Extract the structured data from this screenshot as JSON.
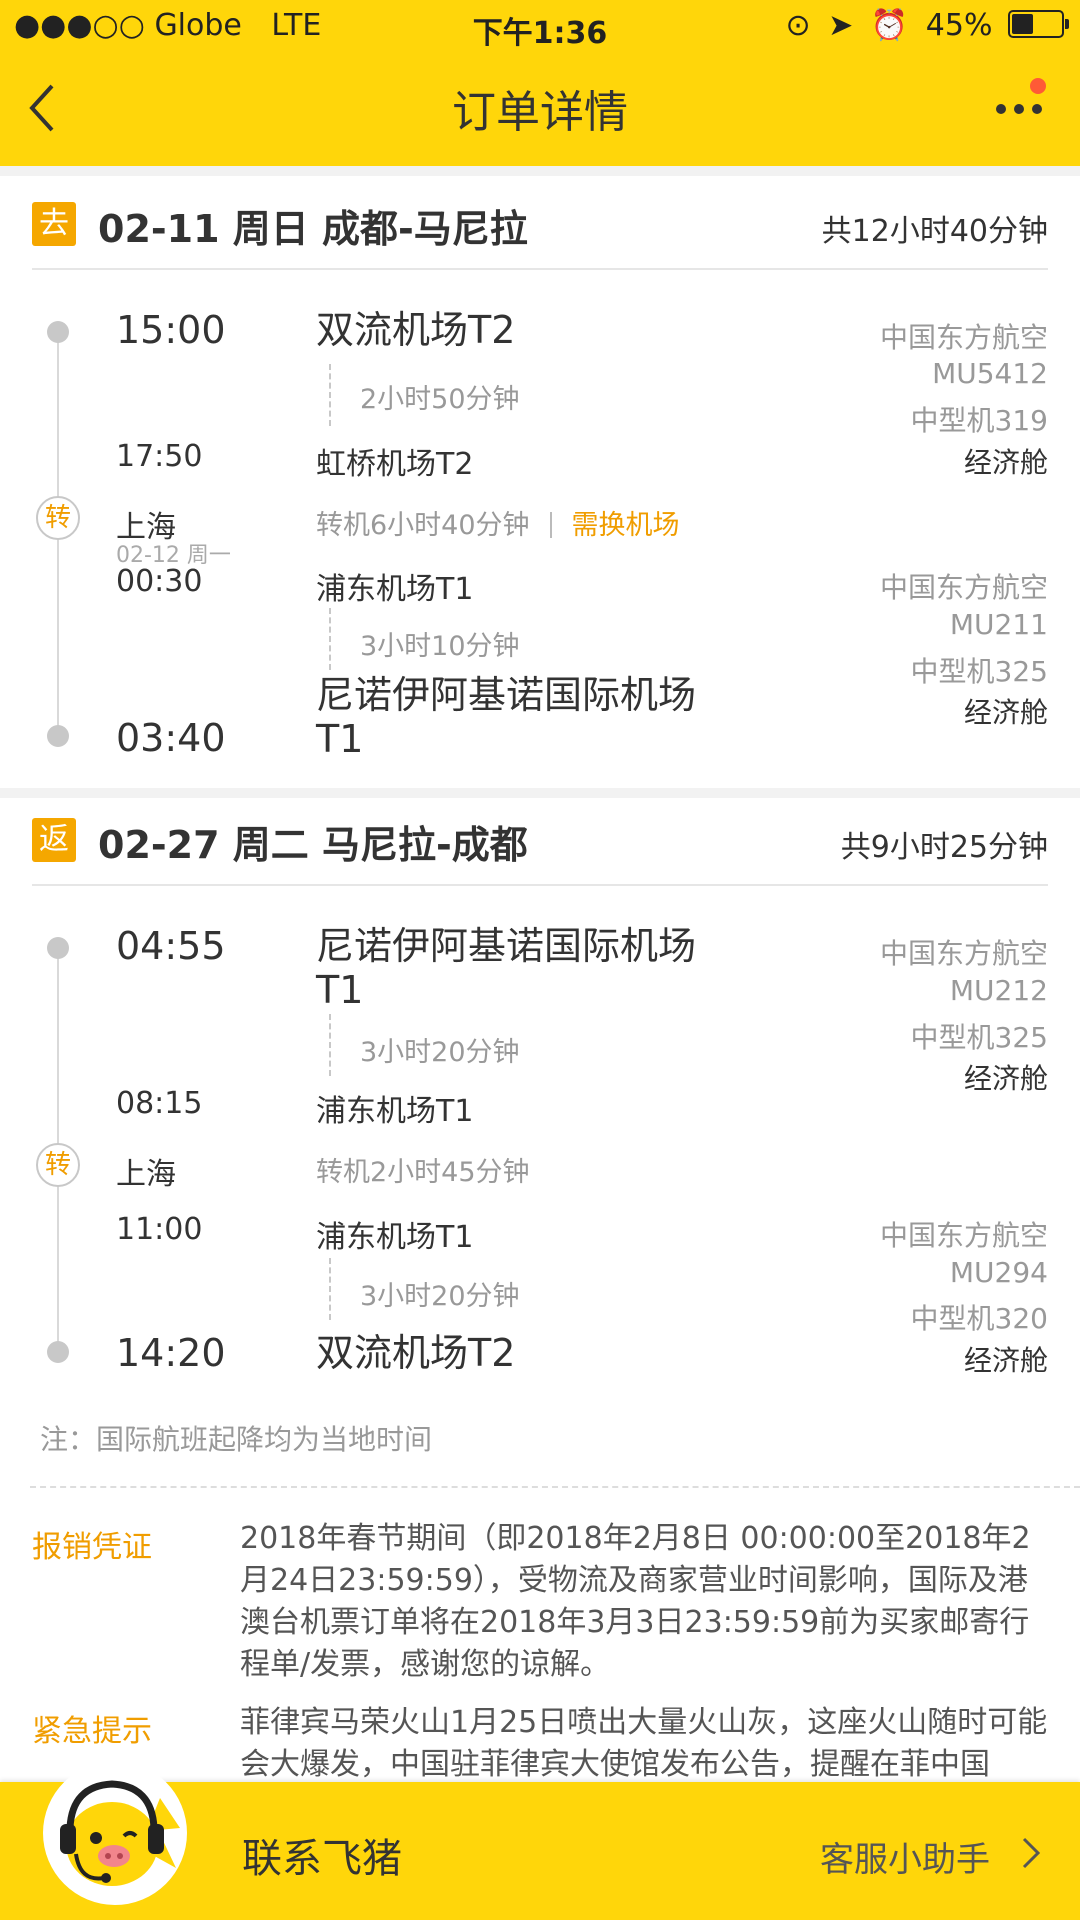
{
  "status_bar": {
    "signal": "●●●○○",
    "carrier": "Globe",
    "network": "LTE",
    "time": "下午1:36",
    "battery": "45%"
  },
  "nav": {
    "title": "订单详情"
  },
  "outbound": {
    "badge": "去",
    "route": "02-11 周日 成都-马尼拉",
    "total": "共12小时40分钟",
    "seg1": {
      "dep_time": "15:00",
      "dep_airport": "双流机场T2",
      "duration": "2小时50分钟",
      "arr_time": "17:50",
      "arr_airport": "虹桥机场T2",
      "airline": "中国东方航空",
      "flight": "MU5412",
      "aircraft": "中型机319",
      "cabin": "经济舱"
    },
    "transfer": {
      "icon": "转",
      "city": "上海",
      "date": "02-12 周一",
      "info": "转机6小时40分钟",
      "warning": "需换机场"
    },
    "seg2": {
      "dep_time": "00:30",
      "dep_airport": "浦东机场T1",
      "duration": "3小时10分钟",
      "arr_time": "03:40",
      "arr_airport_line1": "尼诺伊阿基诺国际机场",
      "arr_airport_line2": "T1",
      "airline": "中国东方航空",
      "flight": "MU211",
      "aircraft": "中型机325",
      "cabin": "经济舱"
    }
  },
  "return": {
    "badge": "返",
    "route": "02-27 周二 马尼拉-成都",
    "total": "共9小时25分钟",
    "seg1": {
      "dep_time": "04:55",
      "dep_airport_line1": "尼诺伊阿基诺国际机场",
      "dep_airport_line2": "T1",
      "duration": "3小时20分钟",
      "arr_time": "08:15",
      "arr_airport": "浦东机场T1",
      "airline": "中国东方航空",
      "flight": "MU212",
      "aircraft": "中型机325",
      "cabin": "经济舱"
    },
    "transfer": {
      "icon": "转",
      "city": "上海",
      "info": "转机2小时45分钟"
    },
    "seg2": {
      "dep_time": "11:00",
      "dep_airport": "浦东机场T1",
      "duration": "3小时20分钟",
      "arr_time": "14:20",
      "arr_airport": "双流机场T2",
      "airline": "中国东方航空",
      "flight": "MU294",
      "aircraft": "中型机320",
      "cabin": "经济舱"
    }
  },
  "note": "注：国际航班起降均为当地时间",
  "reimbursement": {
    "label": "报销凭证",
    "text": "2018年春节期间（即2018年2月8日 00:00:00至2018年2月24日23:59:59），受物流及商家营业时间影响，国际及港澳台机票订单将在2018年3月3日23:59:59前为买家邮寄行程单/发票，感谢您的谅解。"
  },
  "emergency": {
    "label": "紧急提示",
    "text": "菲律宾马荣火山1月25日喷出大量火山灰，这座火山随时可能会大爆发，中国驻菲律宾大使馆发布公告，提醒在菲中国"
  },
  "bottom": {
    "contact": "联系飞猪",
    "assistant": "客服小助手"
  },
  "colors": {
    "brand_yellow": "#ffd60a",
    "accent_orange": "#f09d00"
  }
}
